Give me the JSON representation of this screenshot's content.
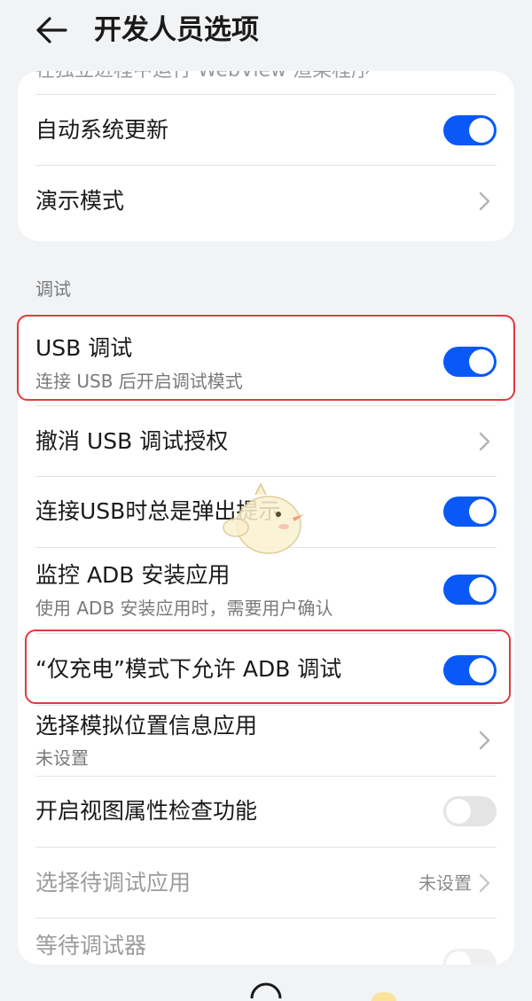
{
  "header": {
    "title": "开发人员选项"
  },
  "top_card": {
    "clipped_text": "在独立进程中运行 WebView 渲染程序",
    "items": [
      {
        "title": "自动系统更新",
        "toggle": "on"
      },
      {
        "title": "演示模式"
      }
    ]
  },
  "debug_section": {
    "label": "调试",
    "items": [
      {
        "title": "USB 调试",
        "subtitle": "连接 USB 后开启调试模式",
        "toggle": "on"
      },
      {
        "title": "撤消 USB 调试授权"
      },
      {
        "title": "连接USB时总是弹出提示",
        "toggle": "on"
      },
      {
        "title": "监控 ADB 安装应用",
        "subtitle": "使用 ADB 安装应用时，需要用户确认",
        "toggle": "on"
      },
      {
        "title": "“仅充电”模式下允许 ADB 调试",
        "toggle": "on"
      },
      {
        "title": "选择模拟位置信息应用",
        "subtitle": "未设置"
      },
      {
        "title": "开启视图属性检查功能",
        "toggle": "off"
      },
      {
        "title": "选择待调试应用",
        "value": "未设置"
      },
      {
        "title": "等待调试器",
        "toggle": "off"
      }
    ]
  },
  "colors": {
    "accent": "#0a59f7",
    "highlight": "#e03a3e",
    "background": "#f1f3f5"
  },
  "icons": [
    "back-arrow-icon",
    "chevron-right-icon",
    "mascot-sticker-icon"
  ]
}
